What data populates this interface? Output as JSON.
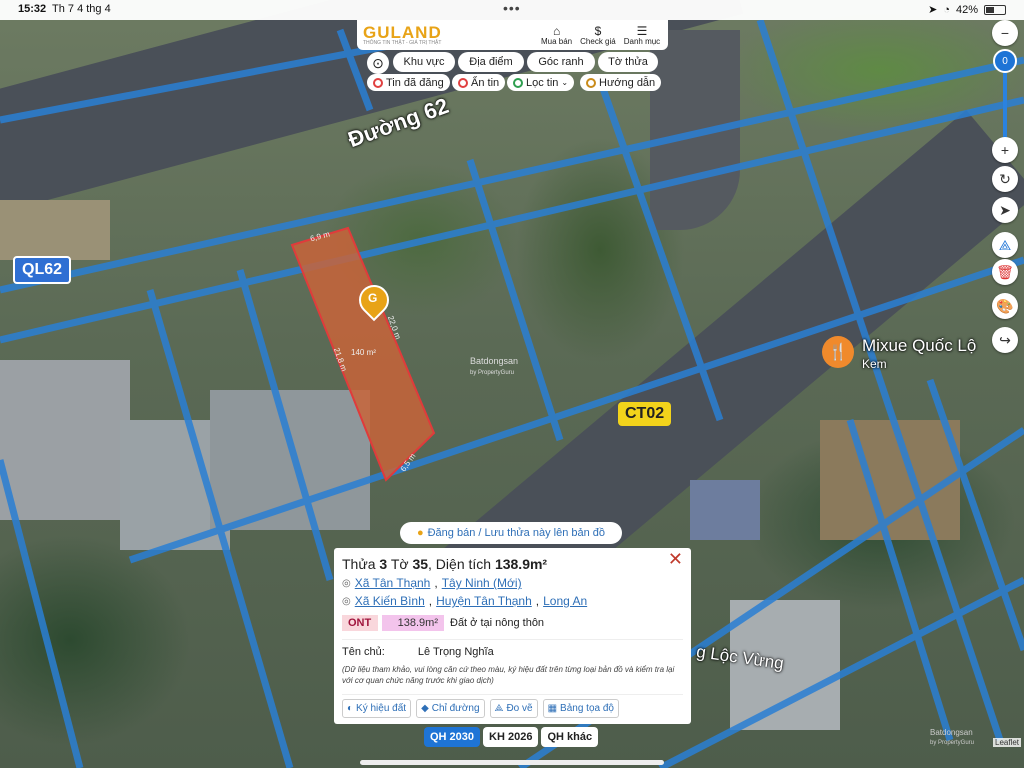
{
  "status_bar": {
    "time": "15:32",
    "date": "Th 7 4 thg 4",
    "battery": "42%"
  },
  "header": {
    "logo": "GULAND",
    "tagline": "THÔNG TIN THẬT - GIÁ TRỊ THẬT",
    "actions": [
      {
        "label": "Mua bán",
        "icon": "house-icon"
      },
      {
        "label": "Check giá",
        "icon": "dollar-icon"
      },
      {
        "label": "Danh mục",
        "icon": "menu-icon"
      }
    ]
  },
  "nav_tabs": [
    "Khu vực",
    "Địa điểm",
    "Góc ranh",
    "Tờ thửa"
  ],
  "filter_pills": [
    {
      "label": "Tin đã đăng",
      "color": "#e04040"
    },
    {
      "label": "Ẩn tin",
      "color": "#e04040"
    },
    {
      "label": "Lọc tin",
      "color": "#2e9e4f"
    },
    {
      "label": "Hướng dẫn",
      "color": "#c98b1a"
    }
  ],
  "map_labels": {
    "street_main": "Đường 62",
    "badge_left": "QL62",
    "badge_right": "CT02",
    "poi_name": "Mixue Quốc Lộ",
    "poi_type": "Kem",
    "street_bottom": "g Lộc Vừng",
    "parcel_area": "140 m²",
    "edge_top": "6,9 m",
    "edge_right": "22,0 m",
    "edge_left": "21,8 m",
    "edge_bottom": "6,5 m",
    "watermark": "Batdongsan",
    "watermark_sub": "by PropertyGuru"
  },
  "zoom_level": "0",
  "register_button": "Đăng bán / Lưu thửa này lên bản đồ",
  "parcel": {
    "title_prefix": "Thửa",
    "parcel_no": "3",
    "sheet_label": "Tờ",
    "sheet_no": "35",
    "area_label": ", Diện tích",
    "area": "138.9m²",
    "address_new": {
      "commune": "Xã Tân Thạnh",
      "province": "Tây Ninh (Mới)"
    },
    "address_old": {
      "commune": "Xã Kiến Bình",
      "district": "Huyện Tân Thạnh",
      "province": "Long An"
    },
    "land_code": "ONT",
    "land_area": "138.9m²",
    "land_type": "Đất ở tại nông thôn",
    "owner_label": "Tên chủ:",
    "owner_name": "Lê Trọng Nghĩa",
    "note": "(Dữ liệu tham khảo, vui lòng căn cứ theo màu, ký hiệu đất trên từng loại bản đồ và kiểm tra lại với cơ quan chức năng trước khi giao dịch)",
    "actions": [
      "Ký hiệu đất",
      "Chỉ đường",
      "Đo vẽ",
      "Bảng tọa độ"
    ]
  },
  "plan_tabs": [
    {
      "label": "QH 2030",
      "active": true
    },
    {
      "label": "KH 2026",
      "active": false
    },
    {
      "label": "QH khác",
      "active": false
    }
  ],
  "attribution": {
    "brand": "Batdongsan",
    "sub": "by PropertyGuru",
    "leaflet": "Leaflet"
  },
  "colors": {
    "accent": "#1e74d6",
    "brand": "#e8a317",
    "parcel_fill": "#c8643a",
    "parcel_border": "#e03b3b",
    "grid": "#2a7fd4"
  }
}
